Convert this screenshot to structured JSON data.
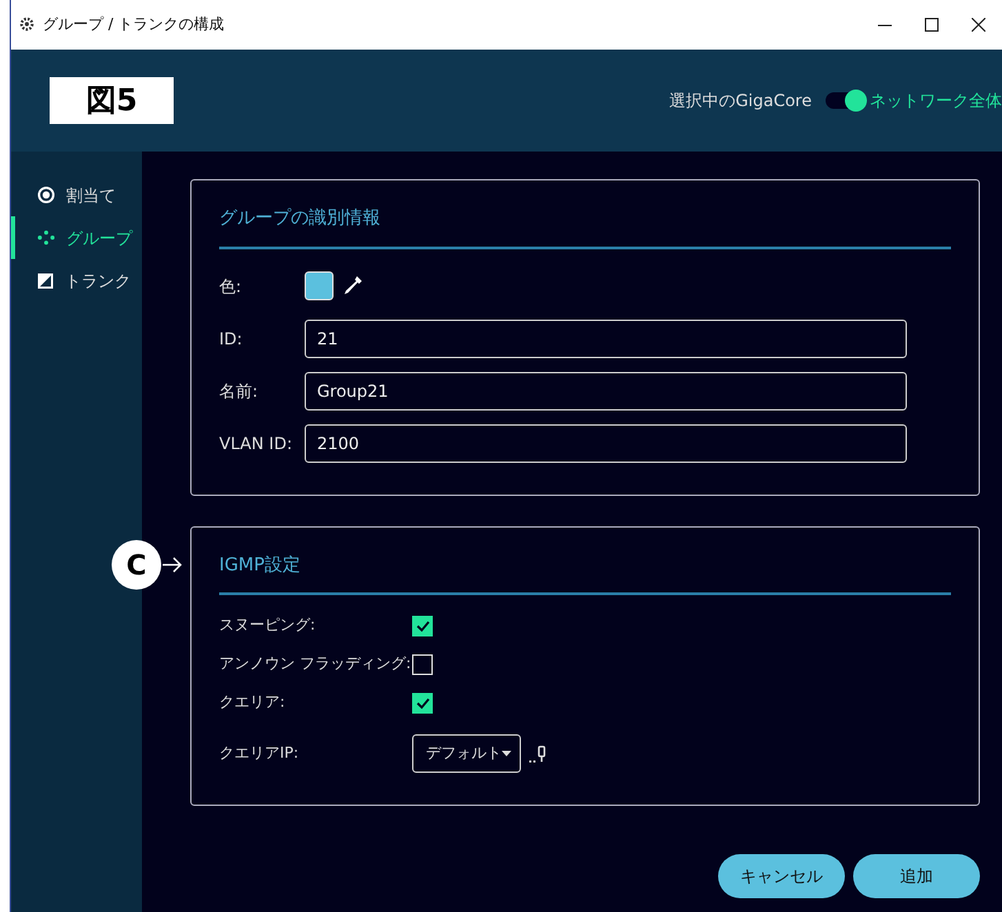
{
  "window": {
    "title": "グループ / トランクの構成"
  },
  "header": {
    "figure_label": "図5",
    "scope_toggle": {
      "left_label": "選択中のGigaCore",
      "right_label": "ネットワーク全体",
      "on": true
    }
  },
  "sidebar": {
    "items": [
      {
        "label": "割当て",
        "kind": "radio",
        "selected": false
      },
      {
        "label": "グループ",
        "kind": "dots",
        "selected": true
      },
      {
        "label": "トランク",
        "kind": "half",
        "selected": false
      }
    ]
  },
  "identity": {
    "title": "グループの識別情報",
    "color_label": "色:",
    "color": "#5bc0de",
    "fields": [
      {
        "label": "ID:",
        "value": "21"
      },
      {
        "label": "名前:",
        "value": "Group21"
      },
      {
        "label": "VLAN ID:",
        "value": "2100"
      }
    ]
  },
  "callout": {
    "label": "C"
  },
  "igmp": {
    "title": "IGMP設定",
    "options": [
      {
        "label": "スヌーピング:",
        "checked": true
      },
      {
        "label": "アンノウン フラッディング:",
        "checked": false
      },
      {
        "label": "クエリア:",
        "checked": true
      }
    ],
    "querier_ip": {
      "label": "クエリアIP:",
      "value": "デフォルト"
    }
  },
  "buttons": [
    {
      "label": "キャンセル"
    },
    {
      "label": "追加"
    }
  ]
}
